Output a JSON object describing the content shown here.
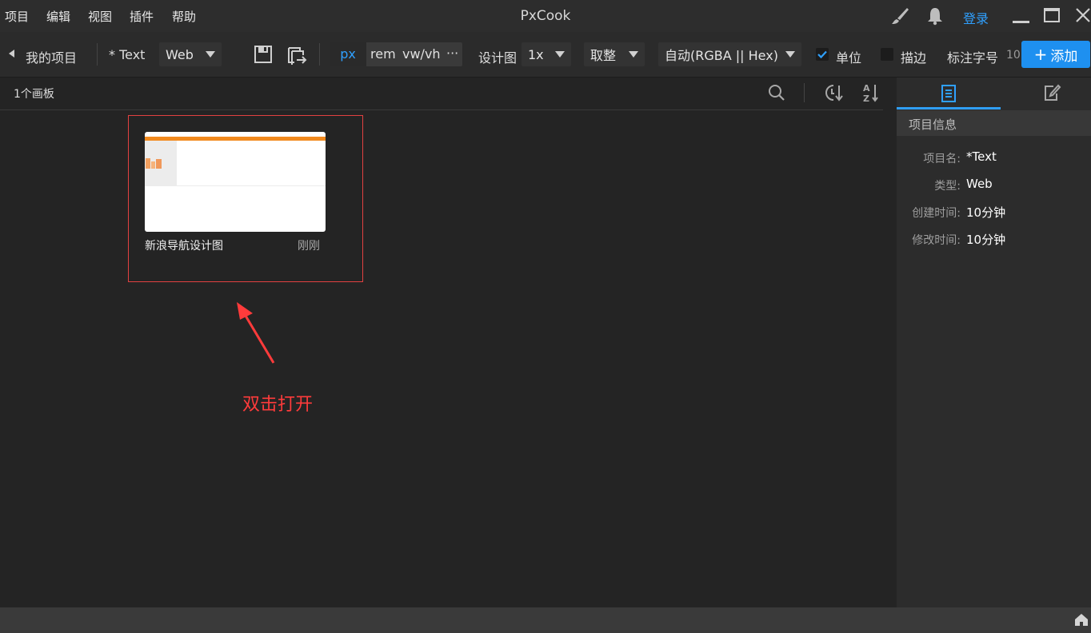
{
  "menu": {
    "items": [
      "项目",
      "编辑",
      "视图",
      "插件",
      "帮助"
    ]
  },
  "window": {
    "title": "PxCook",
    "login_label": "登录"
  },
  "toolbar": {
    "back_label": "我的项目",
    "project_name": "* Text",
    "platform_value": "Web",
    "units": {
      "px": "px",
      "rem": "rem",
      "vw": "vw/vh",
      "more": "···"
    },
    "design_label": "设计图",
    "scale_value": "1x",
    "rounding_value": "取整",
    "color_format_value": "自动(RGBA || Hex)",
    "unit_label": "单位",
    "unit_checked": true,
    "stroke_label": "描边",
    "stroke_checked": false,
    "font_size_label": "标注字号",
    "font_size_value": "10",
    "add_label": "添加"
  },
  "list": {
    "board_count": "1个画板",
    "sort_icons": [
      "search-icon",
      "sort-by-time-icon",
      "sort-az-icon"
    ]
  },
  "artboard": {
    "title": "新浪导航设计图",
    "time": "刚刚"
  },
  "annotation": {
    "text": "双击打开"
  },
  "right_panel": {
    "tabs": [
      "document-icon",
      "edit-icon"
    ],
    "active_tab": 0,
    "info_title": "项目信息",
    "fields": [
      {
        "label": "项目名:",
        "value": "*Text"
      },
      {
        "label": "类型:",
        "value": "Web"
      },
      {
        "label": "创建时间:",
        "value": "10分钟"
      },
      {
        "label": "修改时间:",
        "value": "10分钟"
      }
    ]
  },
  "colors": {
    "accent": "#1e90f0",
    "link": "#2fa0ff",
    "annotation": "#ff3b3b",
    "thumb_stripe": "#f28a1e"
  }
}
